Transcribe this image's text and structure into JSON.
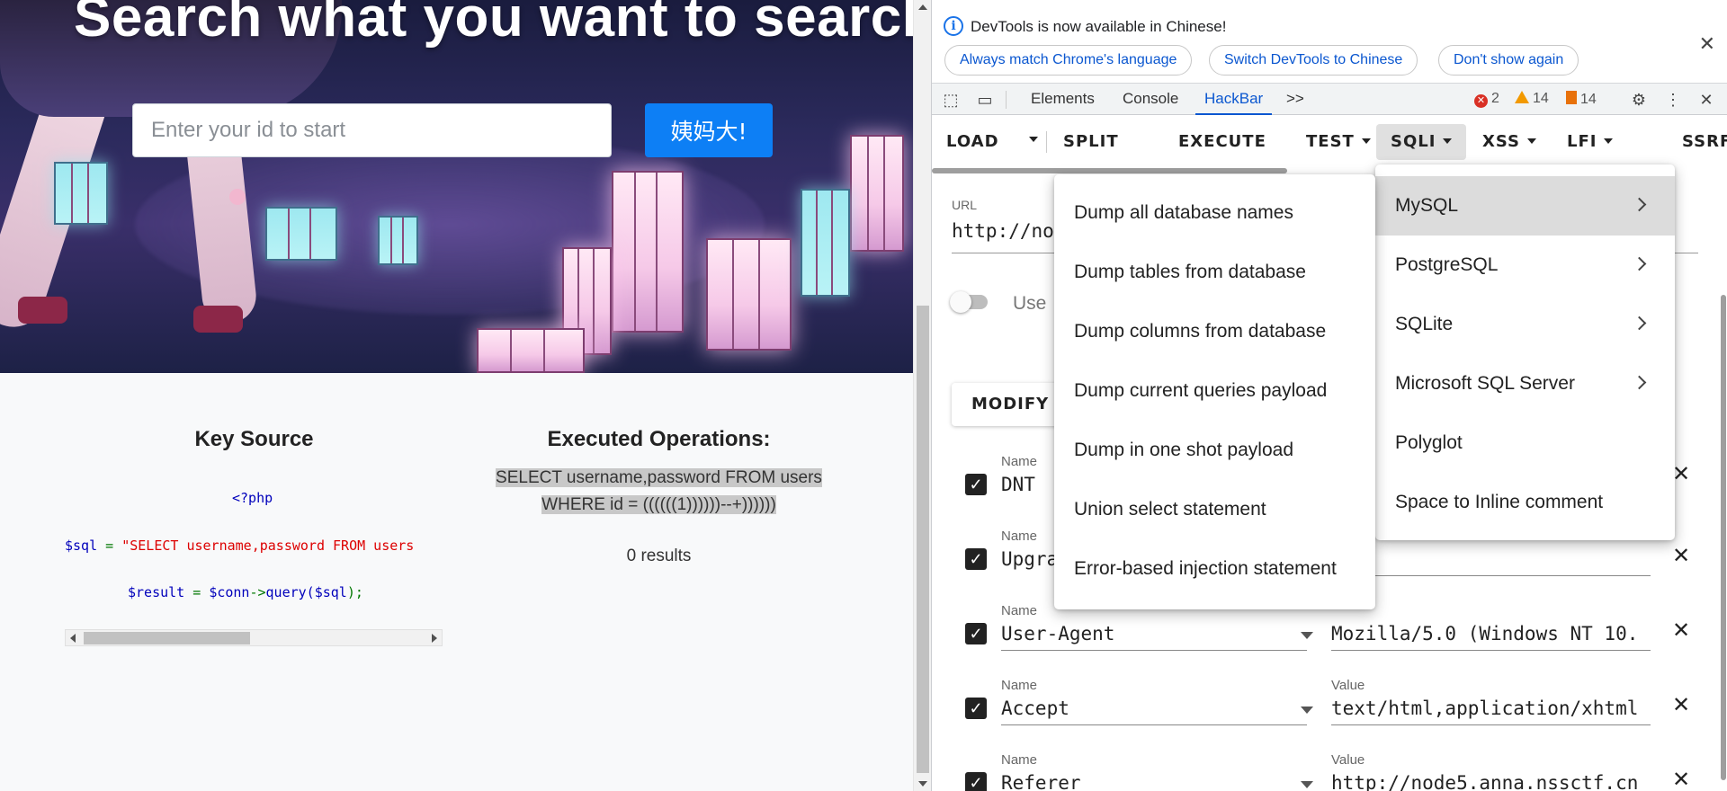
{
  "page": {
    "hero_title": "Search what you want to search",
    "search_placeholder": "Enter your id to start",
    "search_button": "姨妈大!",
    "key_source_title": "Key Source",
    "code": {
      "line1": "<?php",
      "line2_var": "$sql",
      "line2_eq": " = ",
      "line2_str": "\"SELECT username,password FROM users",
      "line3_var": "$result",
      "line3_eq": " = ",
      "line3_obj": "$conn",
      "line3_arrow": "->",
      "line3_call": "query(",
      "line3_arg": "$sql",
      "line3_end": ");"
    },
    "executed_title": "Executed Operations:",
    "executed_sql_line1": "SELECT username,password FROM users",
    "executed_sql_line2": "WHERE id = ((((((1))))))--+))))))",
    "results": "0 results"
  },
  "devtools": {
    "info_text": "DevTools is now available in Chinese!",
    "info_buttons": [
      "Always match Chrome's language",
      "Switch DevTools to Chinese",
      "Don't show again"
    ],
    "tabs": [
      "Elements",
      "Console",
      "HackBar"
    ],
    "active_tab": "HackBar",
    "more_tabs": ">>",
    "errors": "2",
    "warnings": "14",
    "issues": "14"
  },
  "hackbar": {
    "toolbar": [
      "LOAD",
      "SPLIT",
      "EXECUTE",
      "TEST",
      "SQLI",
      "XSS",
      "LFI",
      "SSRF"
    ],
    "url_label": "URL",
    "url_value": "http://no",
    "toggle_label": "Use",
    "modify_button": "MODIFY H",
    "name_label": "Name",
    "value_label": "Value",
    "headers": [
      {
        "name": "DNT",
        "value": ""
      },
      {
        "name": "Upgra",
        "value": ""
      },
      {
        "name": "User-Agent",
        "value": "Mozilla/5.0 (Windows NT 10."
      },
      {
        "name": "Accept",
        "value": "text/html,application/xhtml"
      },
      {
        "name": "Referer",
        "value": "http://node5.anna.nssctf.cn"
      }
    ]
  },
  "sqli_menu": [
    "MySQL",
    "PostgreSQL",
    "SQLite",
    "Microsoft SQL Server",
    "Polyglot",
    "Space to Inline comment"
  ],
  "mysql_menu": [
    "Dump all database names",
    "Dump tables from database",
    "Dump columns from database",
    "Dump current queries payload",
    "Dump in one shot payload",
    "Union select statement",
    "Error-based injection statement"
  ]
}
